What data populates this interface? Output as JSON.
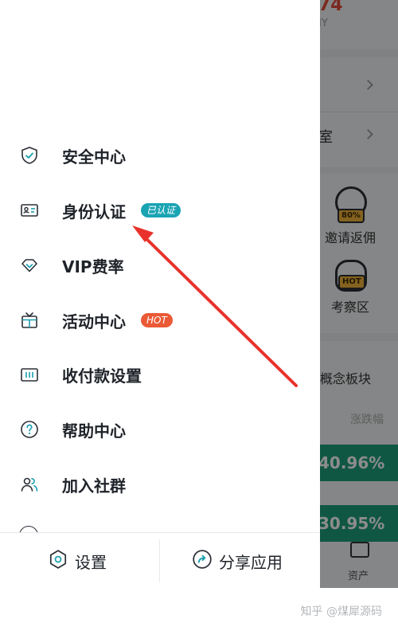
{
  "background_app": {
    "top_number_fragment": "74",
    "top_label_fragment": "IY",
    "row_text_fragment": "室",
    "invite_label": "邀请返佣",
    "invite_badge": "80%",
    "observe_label": "考察区",
    "observe_badge": "HOT",
    "concept_sectors": "概念板块",
    "change_header": "涨跌幅",
    "change_values": [
      "40.96%",
      "30.95%"
    ],
    "assets_label": "资产"
  },
  "drawer": {
    "menu": [
      {
        "label": "安全中心",
        "icon": "shield-icon"
      },
      {
        "label": "身份认证",
        "icon": "id-card-icon",
        "badge": "已认证"
      },
      {
        "label": "VIP费率",
        "icon": "diamond-icon"
      },
      {
        "label": "活动中心",
        "icon": "gift-box-icon",
        "badge": "HOT"
      },
      {
        "label": "收付款设置",
        "icon": "payment-icon"
      },
      {
        "label": "帮助中心",
        "icon": "help-icon"
      },
      {
        "label": "加入社群",
        "icon": "community-icon"
      }
    ],
    "bottom": {
      "settings_label": "设置",
      "share_label": "分享应用"
    }
  },
  "watermark": "知乎 @煤犀源码",
  "colors": {
    "accent_teal": "#1aa4b3",
    "hot_orange": "#ea5a36",
    "icon_teal": "#1a9fae",
    "arrow_red": "#e8322b",
    "bg_green": "#1e9f7a"
  }
}
